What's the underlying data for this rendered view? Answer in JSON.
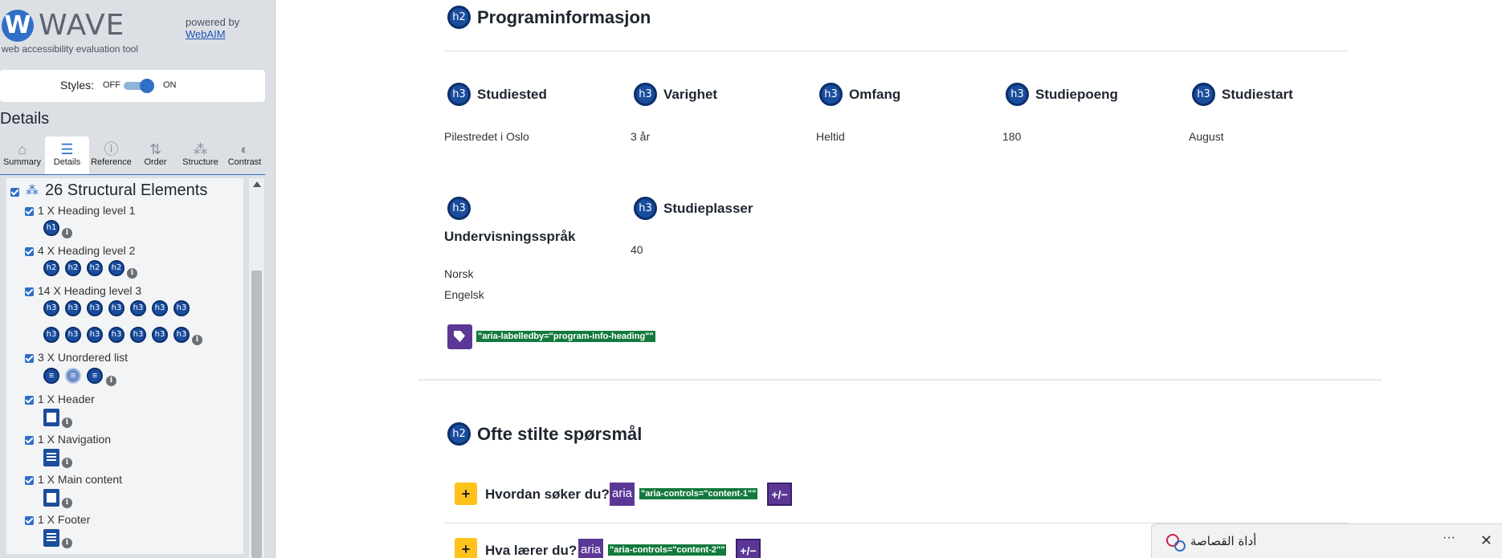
{
  "wave": {
    "logo_word": "WAVE",
    "logo_letter": "W",
    "subtitle": "web accessibility evaluation tool",
    "powered_by": "powered by",
    "webaim": "WebAIM",
    "styles": {
      "label": "Styles:",
      "off": "OFF",
      "on": "ON"
    },
    "details_title": "Details",
    "tabs": [
      {
        "label": "Summary",
        "icon": "home-icon"
      },
      {
        "label": "Details",
        "icon": "list-icon"
      },
      {
        "label": "Reference",
        "icon": "info-icon"
      },
      {
        "label": "Order",
        "icon": "order-icon"
      },
      {
        "label": "Structure",
        "icon": "structure-icon"
      },
      {
        "label": "Contrast",
        "icon": "contrast-icon"
      }
    ],
    "category_title": "26 Structural Elements",
    "items": [
      {
        "label": "1 X Heading level 1",
        "badge": "h1"
      },
      {
        "label": "4 X Heading level 2",
        "badge": "h2"
      },
      {
        "label": "14 X Heading level 3",
        "badge": "h3"
      },
      {
        "label": "3 X Unordered list"
      },
      {
        "label": "1 X Header"
      },
      {
        "label": "1 X Navigation"
      },
      {
        "label": "1 X Main content"
      },
      {
        "label": "1 X Footer"
      }
    ],
    "info_glyph": "i"
  },
  "page": {
    "program_heading": "Programinformasjon",
    "h2_badge": "h2",
    "h3_badge": "h3",
    "fields": [
      {
        "label": "Studiested",
        "value": "Pilestredet i Oslo"
      },
      {
        "label": "Varighet",
        "value": "3 år"
      },
      {
        "label": "Omfang",
        "value": "Heltid"
      },
      {
        "label": "Studiepoeng",
        "value": "180"
      },
      {
        "label": "Studiestart",
        "value": "August"
      },
      {
        "label": "Undervisningsspråk",
        "values": [
          "Norsk",
          "Engelsk"
        ]
      },
      {
        "label": "Studieplasser",
        "value": "40"
      }
    ],
    "aria_labelledby": "\"aria-labelledby=\"program-info-heading\"\"",
    "faq_heading": "Ofte stilte spørsmål",
    "faq": [
      {
        "question": "Hvordan søker du?",
        "aria": "aria",
        "controls": "\"aria-controls=\"content-1\"\"",
        "toggle": "+/−",
        "plus": "+"
      },
      {
        "question": "Hva lærer du?",
        "aria": "aria",
        "controls": "\"aria-controls=\"content-2\"\"",
        "toggle": "+/−",
        "plus": "+"
      }
    ]
  },
  "toast": {
    "label": "أداة القصاصة",
    "dots": "···",
    "close": "✕"
  }
}
